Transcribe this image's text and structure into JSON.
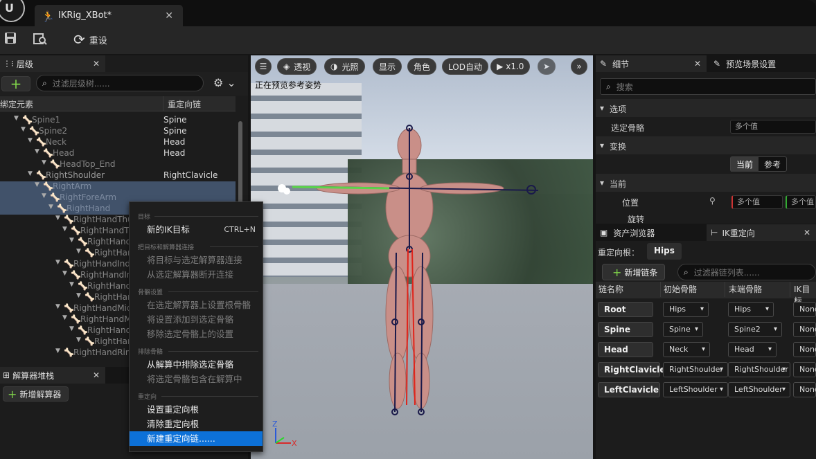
{
  "window": {
    "doc_tab_title": "IKRig_XBot*",
    "close_glyph": "✕"
  },
  "toolbar": {
    "save_icon": "save-icon",
    "browse_icon": "browse-asset-icon",
    "reset_label": "重设"
  },
  "hierarchy": {
    "tab_label": "层级",
    "filter_placeholder": "过滤层级树......",
    "col_bone": "绑定元素",
    "col_chain": "重定向链",
    "rows": [
      {
        "name": "Spine1",
        "chain": "Spine"
      },
      {
        "name": "Spine2",
        "chain": "Spine"
      },
      {
        "name": "Neck",
        "chain": "Head"
      },
      {
        "name": "Head",
        "chain": "Head"
      },
      {
        "name": "HeadTop_End",
        "chain": ""
      },
      {
        "name": "RightShoulder",
        "chain": "RightClavicle"
      },
      {
        "name": "RightArm",
        "chain": ""
      },
      {
        "name": "RightForeArm",
        "chain": ""
      },
      {
        "name": "RightHand",
        "chain": ""
      },
      {
        "name": "RightHandThu",
        "chain": ""
      },
      {
        "name": "RightHandTh",
        "chain": ""
      },
      {
        "name": "RightHand",
        "chain": ""
      },
      {
        "name": "RightHan",
        "chain": ""
      },
      {
        "name": "RightHandInde",
        "chain": ""
      },
      {
        "name": "RightHandIn",
        "chain": ""
      },
      {
        "name": "RightHand",
        "chain": ""
      },
      {
        "name": "RightHan",
        "chain": ""
      },
      {
        "name": "RightHandMid",
        "chain": ""
      },
      {
        "name": "RightHandM",
        "chain": ""
      },
      {
        "name": "RightHand",
        "chain": ""
      },
      {
        "name": "RightHan",
        "chain": ""
      },
      {
        "name": "RightHandRing",
        "chain": ""
      }
    ]
  },
  "solver": {
    "tab_label": "解算器堆栈",
    "add_label": "新增解算器"
  },
  "viewport": {
    "btn_menu": "☰",
    "btn_perspective": "透视",
    "btn_lit": "光照",
    "btn_show": "显示",
    "btn_character": "角色",
    "btn_lod": "LOD自动",
    "btn_speed": "x1.0",
    "status_text": "正在预览参考姿势",
    "axis_z": "Z",
    "axis_x": "X"
  },
  "context_menu": {
    "sec_goal": "目标",
    "new_goal": "新的IK目标",
    "new_goal_shortcut": "CTRL+N",
    "sec_connect": "把目标和解算器连接",
    "connect_goal": "将目标与选定解算器连接",
    "disconnect_goal": "从选定解算器断开连接",
    "sec_bone_settings": "骨骼设置",
    "set_root_bone": "在选定解算器上设置根骨骼",
    "add_settings": "将设置添加到选定骨骼",
    "remove_settings": "移除选定骨骼上的设置",
    "sec_exclude": "排除骨骼",
    "exclude_bone": "从解算中排除选定骨骼",
    "include_bone": "将选定骨骼包含在解算中",
    "sec_retarget": "重定向",
    "set_retarget_root": "设置重定向根",
    "clear_retarget_root": "清除重定向根",
    "new_retarget_chain": "新建重定向链......"
  },
  "details": {
    "tab_label": "细节",
    "preview_tab_label": "预览场景设置",
    "search_placeholder": "搜索",
    "sec_options": "选项",
    "selected_bone_label": "选定骨骼",
    "multi_value": "多个值",
    "sec_transform": "变换",
    "btn_current": "当前",
    "btn_reference": "参考",
    "sec_current": "当前",
    "position_label": "位置",
    "rotation_label": "旋转"
  },
  "ik_retarget": {
    "asset_tab_label": "资产浏览器",
    "tab_label": "IK重定向",
    "root_label": "重定向根：",
    "root_value": "Hips",
    "add_chain_label": "新增链条",
    "filter_placeholder": "过滤器链列表......",
    "col_chain": "链名称",
    "col_start": "初始骨骼",
    "col_end": "末端骨骼",
    "col_goal": "IK目标",
    "chains": [
      {
        "name": "Root",
        "start": "Hips",
        "end": "Hips",
        "goal": "None"
      },
      {
        "name": "Spine",
        "start": "Spine",
        "end": "Spine2",
        "goal": "None"
      },
      {
        "name": "Head",
        "start": "Neck",
        "end": "Head",
        "goal": "None"
      },
      {
        "name": "RightClavicle",
        "start": "RightShoulder",
        "end": "RightShoulder",
        "goal": "None"
      },
      {
        "name": "LeftClavicle",
        "start": "LeftShoulder",
        "end": "LeftShoulder",
        "goal": "None"
      }
    ]
  },
  "colors": {
    "accent": "#0d71d8",
    "selection": "#41526a",
    "add_green": "#7fd34a",
    "panel_bg": "#1c1c1c"
  }
}
